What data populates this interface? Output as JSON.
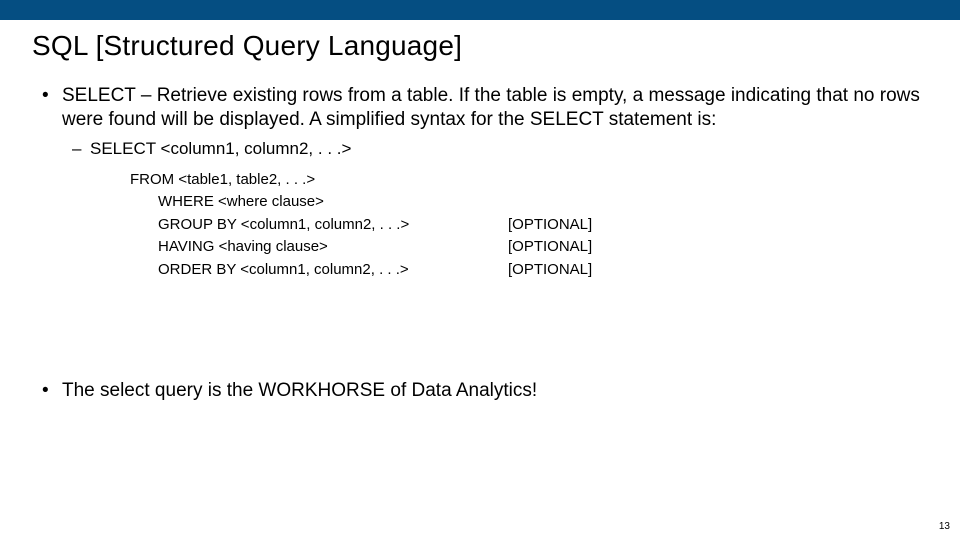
{
  "title": "SQL [Structured Query Language]",
  "bullet1": "SELECT – Retrieve existing rows from a table. If the table is empty, a message indicating that no rows were found will be displayed. A simplified syntax for the SELECT statement is:",
  "sub1": "SELECT <column1, column2, . . .>",
  "fromLine": "FROM   <table1, table2, . . .>",
  "clauses": {
    "where": {
      "text": "WHERE   <where clause>",
      "opt": ""
    },
    "groupby": {
      "text": "GROUP BY <column1, column2, . . .>",
      "opt": "[OPTIONAL]"
    },
    "having": {
      "text": "HAVING   <having clause>",
      "opt": "[OPTIONAL]"
    },
    "orderby": {
      "text": "ORDER BY <column1, column2, . . .>",
      "opt": "[OPTIONAL]"
    }
  },
  "bullet2": "The select query is the WORKHORSE of Data Analytics!",
  "pageNumber": "13"
}
